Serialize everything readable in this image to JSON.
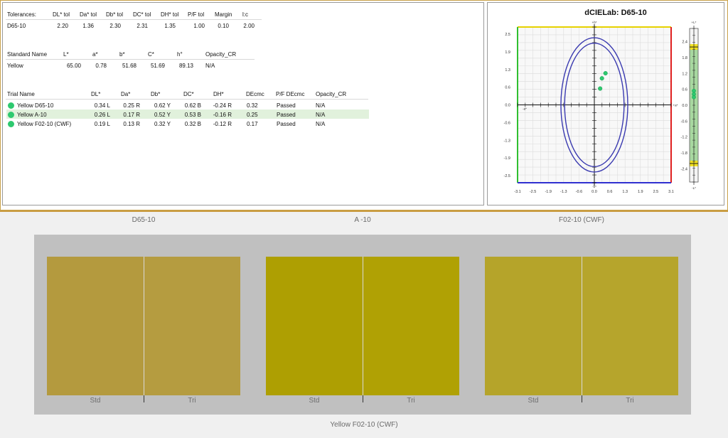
{
  "tolerances": {
    "headers": [
      "Tolerances:",
      "DL* tol",
      "Da* tol",
      "Db* tol",
      "DC* tol",
      "DH* tol",
      "P/F tol",
      "Margin",
      "l:c"
    ],
    "values": [
      "D65-10",
      "2.20",
      "1.36",
      "2.30",
      "2.31",
      "1.35",
      "1.00",
      "0.10",
      "2.00"
    ]
  },
  "standard": {
    "headers": [
      "Standard Name",
      "L*",
      "a*",
      "b*",
      "C*",
      "h°",
      "Opacity_CR"
    ],
    "values": [
      "Yellow",
      "65.00",
      "0.78",
      "51.68",
      "51.69",
      "89.13",
      "N/A"
    ]
  },
  "trials": {
    "headers": [
      "Trial Name",
      "DL*",
      "Da*",
      "Db*",
      "DC*",
      "DH*",
      "DEcmc",
      "P/F DEcmc",
      "Opacity_CR"
    ],
    "rows": [
      [
        "Yellow D65-10",
        "0.34 L",
        "0.25 R",
        "0.62 Y",
        "0.62 B",
        "-0.24 R",
        "0.32",
        "Passed",
        "N/A"
      ],
      [
        "Yellow A-10",
        "0.26 L",
        "0.17 R",
        "0.52 Y",
        "0.53 B",
        "-0.16 R",
        "0.25",
        "Passed",
        "N/A"
      ],
      [
        "Yellow F02-10 (CWF)",
        "0.19 L",
        "0.13 R",
        "0.32 Y",
        "0.32 B",
        "-0.12 R",
        "0.17",
        "Passed",
        "N/A"
      ]
    ],
    "highlighted_row": 1,
    "dot_color": "#2ec96f",
    "highlight_color": "#e1f1dc"
  },
  "chart": {
    "title": "dCIELab: D65-10",
    "axis_ticks": [
      "-3.1",
      "-2.5",
      "-1.9",
      "-1.3",
      "-0.6",
      "0.0",
      "0.6",
      "1.3",
      "1.9",
      "2.5",
      "3.1"
    ],
    "y_ticks": [
      "2.5",
      "1.9",
      "1.3",
      "0.6",
      "0.0",
      "-0.6",
      "-1.3",
      "-1.9",
      "-2.5"
    ],
    "axis_labels": {
      "top": "+b*",
      "bottom": "-b*",
      "left": "-a*",
      "right": "+a*"
    },
    "points": [
      {
        "da": 0.25,
        "db": 0.62
      },
      {
        "da": 0.17,
        "db": 0.52
      },
      {
        "da": 0.13,
        "db": 0.32
      }
    ],
    "ellipses": [
      {
        "rx": 1.35,
        "ry": 2.5
      },
      {
        "rx": 1.2,
        "ry": 2.3
      }
    ],
    "colors": {
      "yellow": "#e6d200",
      "red": "#e02020",
      "green": "#30c030",
      "blue": "#3030d0",
      "ellipse": "#3a3ab0"
    }
  },
  "lightness_bar": {
    "top_label": "+L*",
    "bottom_label": "-L*",
    "ticks": [
      "2.4",
      "1.8",
      "1.2",
      "0.6",
      "0.0",
      "-0.6",
      "-1.2",
      "-1.8",
      "-2.4"
    ],
    "tolerance": 2.2,
    "points": [
      0.34,
      0.26,
      0.19
    ],
    "band_color": "#a8d8a0",
    "tol_color": "#f0e020"
  },
  "illuminants": {
    "titles": [
      "D65-10",
      "A  -10",
      "F02-10 (CWF)"
    ],
    "std_label": "Std",
    "tri_label": "Tri",
    "swatches": [
      {
        "std": "#b49a3e",
        "tri": "#b59c40"
      },
      {
        "std": "#ae9f02",
        "tri": "#b0a104"
      },
      {
        "std": "#b5a42a",
        "tri": "#b6a52c"
      }
    ],
    "footer": "Yellow F02-10 (CWF)"
  }
}
